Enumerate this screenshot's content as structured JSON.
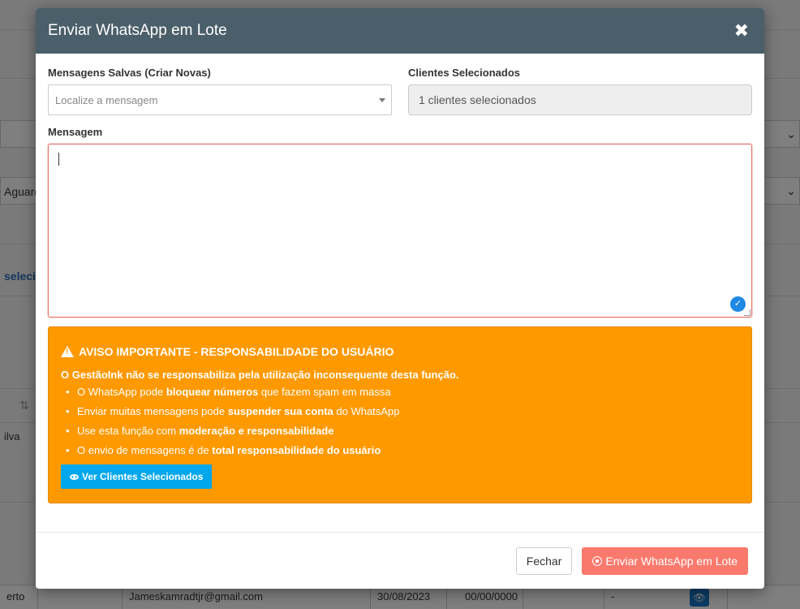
{
  "background": {
    "fragments": {
      "status": "Aguard",
      "selected_link": "selecio",
      "name_fragment": "ilva",
      "name_fragment_2": "erto",
      "sort_icon": "⇅"
    },
    "table_row": {
      "email": "Jameskamradtjr@gmail.com",
      "date1": "30/08/2023",
      "date2": "00/00/0000",
      "dash": "-"
    }
  },
  "modal": {
    "title": "Enviar WhatsApp em Lote",
    "close_glyph": "✖",
    "saved_messages": {
      "label": "Mensagens Salvas (Criar Novas)",
      "placeholder": "Localize a mensagem"
    },
    "selected_clients": {
      "label": "Clientes Selecionados",
      "value": "1 clientes selecionados"
    },
    "message": {
      "label": "Mensagem",
      "value": ""
    },
    "warning": {
      "title": "AVISO IMPORTANTE - RESPONSABILIDADE DO USUÁRIO",
      "lead": "O GestãoInk não se responsabiliza pela utilização inconsequente desta função.",
      "items": [
        {
          "pre": "O WhatsApp pode ",
          "bold": "bloquear números",
          "post": " que fazem spam em massa"
        },
        {
          "pre": "Enviar muitas mensagens pode ",
          "bold": "suspender sua conta",
          "post": " do WhatsApp"
        },
        {
          "pre": "Use esta função com ",
          "bold": "moderação e responsabilidade",
          "post": ""
        },
        {
          "pre": "O envio de mensagens é de ",
          "bold": "total responsabilidade do usuário",
          "post": ""
        }
      ],
      "button_label": "Ver Clientes Selecionados"
    },
    "footer": {
      "close_label": "Fechar",
      "send_label": "Enviar WhatsApp em Lote"
    }
  }
}
